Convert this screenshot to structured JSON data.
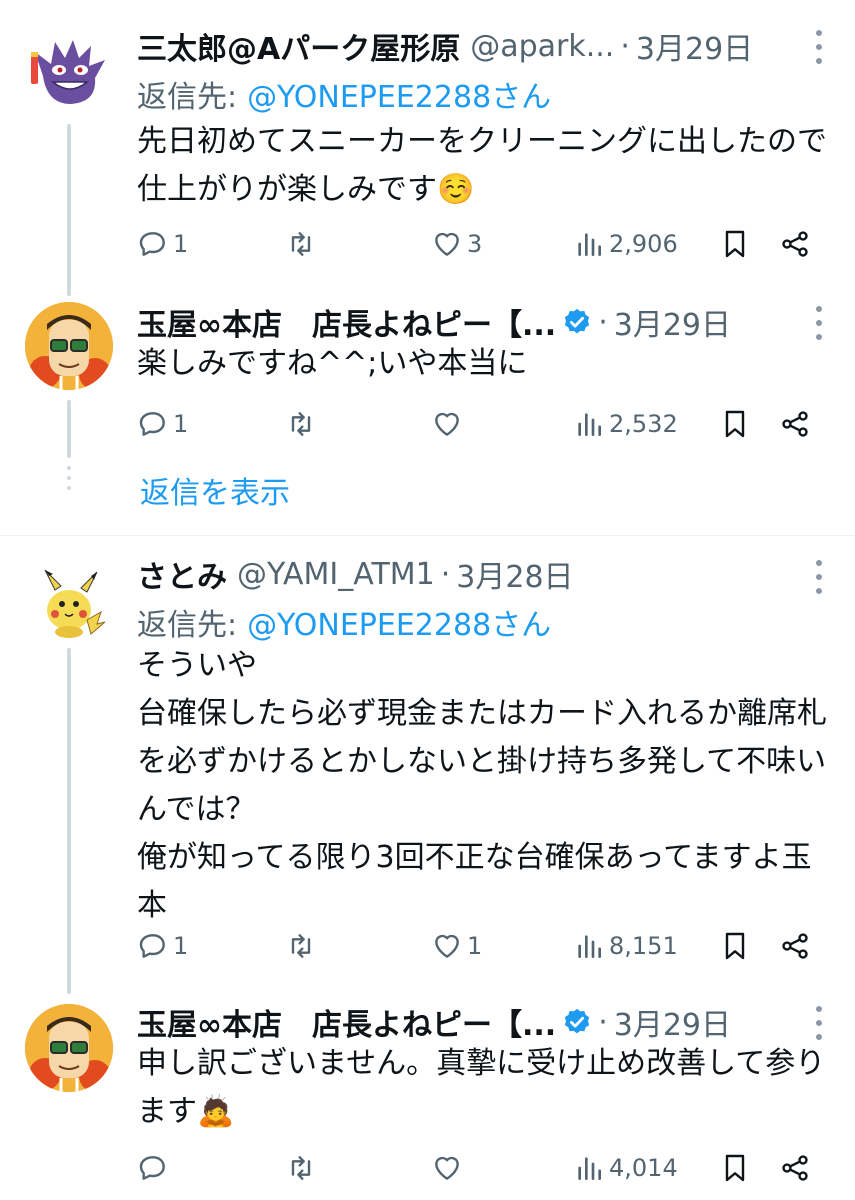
{
  "replies": [
    {
      "name": "三太郎@Aパーク屋形原",
      "handle": "@apark...",
      "date": "3月29日",
      "reply_to_label": "返信先:",
      "reply_to_mention": "@YONEPEE2288さん",
      "text": "先日初めてスニーカーをクリーニングに出したので仕上がりが楽しみです☺️",
      "replies_count": "1",
      "retweets_count": "",
      "likes_count": "3",
      "views_count": "2,906",
      "avatar_icon": "ghost-monster-avatar"
    },
    {
      "name": "玉屋∞本店　店長よねピー【...",
      "verified": true,
      "date": "3月29日",
      "text": "楽しみですね^^;いや本当に",
      "replies_count": "1",
      "retweets_count": "",
      "likes_count": "",
      "views_count": "2,532",
      "avatar_icon": "man-with-glasses-avatar"
    },
    {
      "name": "さとみ",
      "handle": "@YAMI_ATM1",
      "date": "3月28日",
      "reply_to_label": "返信先:",
      "reply_to_mention": "@YONEPEE2288さん",
      "text": "そういや\n台確保したら必ず現金またはカード入れるか離席札を必ずかけるとかしないと掛け持ち多発して不味いんでは？\n俺が知ってる限り3回不正な台確保あってますよ玉本",
      "replies_count": "1",
      "retweets_count": "",
      "likes_count": "1",
      "views_count": "8,151",
      "avatar_icon": "yellow-mouse-avatar"
    },
    {
      "name": "玉屋∞本店　店長よねピー【...",
      "verified": true,
      "date": "3月29日",
      "text": "申し訳ございません。真摯に受け止め改善して参ります🙇",
      "replies_count": "",
      "retweets_count": "",
      "likes_count": "",
      "views_count": "4,014",
      "avatar_icon": "man-with-glasses-avatar"
    }
  ],
  "show_replies_label": "返信を表示",
  "colors": {
    "accent": "#1d9bf0",
    "muted": "#536471",
    "text": "#0f1419",
    "line": "#cfd9de"
  }
}
